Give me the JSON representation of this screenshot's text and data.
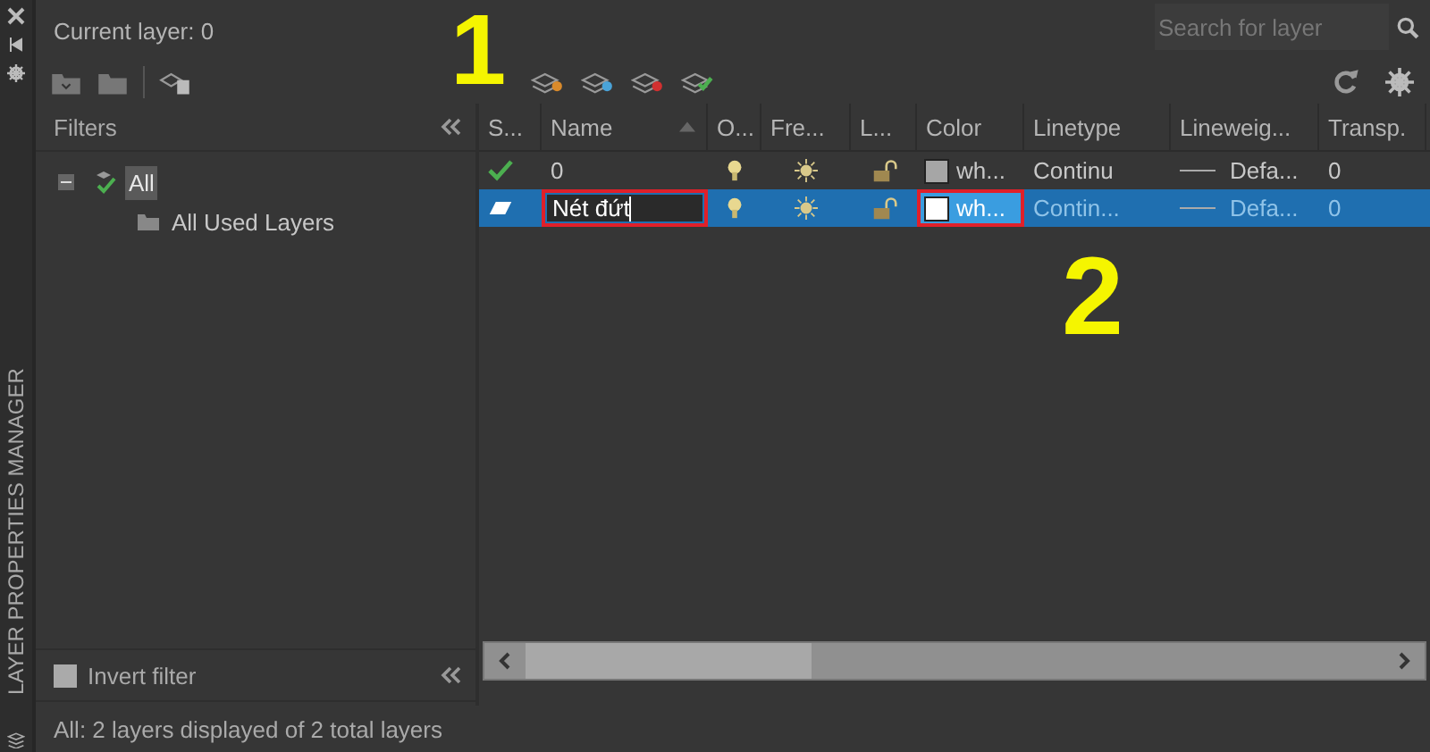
{
  "panel_title": "LAYER PROPERTIES MANAGER",
  "current_layer": "Current layer: 0",
  "search": {
    "placeholder": "Search for layer"
  },
  "filters": {
    "title": "Filters",
    "tree": [
      {
        "label": "All",
        "selected": true,
        "expanded": true,
        "children": [
          {
            "label": "All Used Layers",
            "selected": false
          }
        ]
      }
    ],
    "invert_filter": {
      "label": "Invert filter",
      "checked": false
    }
  },
  "columns": [
    {
      "label": "S...",
      "sorted": false
    },
    {
      "label": "Name",
      "sorted": true
    },
    {
      "label": "O...",
      "sorted": false
    },
    {
      "label": "Fre...",
      "sorted": false
    },
    {
      "label": "L...",
      "sorted": false
    },
    {
      "label": "Color",
      "sorted": false
    },
    {
      "label": "Linetype",
      "sorted": false
    },
    {
      "label": "Lineweig...",
      "sorted": false
    },
    {
      "label": "Transp.",
      "sorted": false
    }
  ],
  "rows": [
    {
      "kind": "current",
      "name": "0",
      "editing": false,
      "selected": false,
      "on": true,
      "frozen": false,
      "locked": false,
      "color": "#a6a6a6",
      "color_name": "wh...",
      "linetype": "Continu",
      "lineweight": "Defa...",
      "transparency": "0",
      "name_marked": false,
      "color_marked": false
    },
    {
      "kind": "new",
      "name": "Nét đứt",
      "editing": true,
      "selected": true,
      "on": true,
      "frozen": false,
      "locked": false,
      "color": "#ffffff",
      "color_name": "wh...",
      "linetype": "Contin...",
      "lineweight": "Defa...",
      "transparency": "0",
      "name_marked": true,
      "color_marked": true
    }
  ],
  "status": "All: 2 layers displayed of 2 total layers",
  "callouts": [
    {
      "text": "1"
    },
    {
      "text": "2"
    }
  ]
}
